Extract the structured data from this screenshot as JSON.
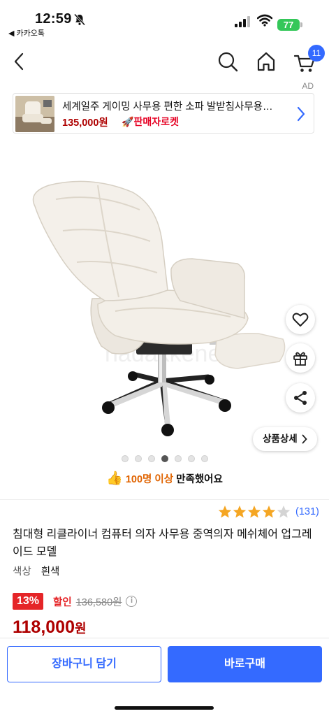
{
  "status_bar": {
    "time": "12:59",
    "back_app": "◀ 카카오톡",
    "battery": "77"
  },
  "nav": {
    "cart_count": "11"
  },
  "ad": {
    "label": "AD",
    "title": "세계일주 게이밍 사무용 편한 소파 발받침사무용…",
    "price": "135,000원",
    "delivery": "판매자로켓"
  },
  "product_image": {
    "detail_button": "상품상세",
    "watermark": "nadakkene.co",
    "carousel_total": 7,
    "carousel_active": 4
  },
  "satisfaction": {
    "highlight": "100명 이상",
    "text": " 만족했어요"
  },
  "rating": {
    "stars": 4,
    "count": "(131)"
  },
  "product": {
    "title": "침대형 리클라이너 컴퓨터 의자 사무용 중역의자 메쉬체어 업그레이드 모델",
    "color_label": "색상",
    "color_value": "흰색",
    "discount_rate": "13%",
    "discount_label": "할인",
    "original_price": "136,580원",
    "sale_price": "118,000",
    "sale_unit": "원"
  },
  "bottom": {
    "cart_button": "장바구니 담기",
    "buy_button": "바로구매"
  },
  "colors": {
    "accent": "#346aff",
    "price_red": "#ae0000",
    "discount_red": "#e52528",
    "star": "#f5a623"
  }
}
